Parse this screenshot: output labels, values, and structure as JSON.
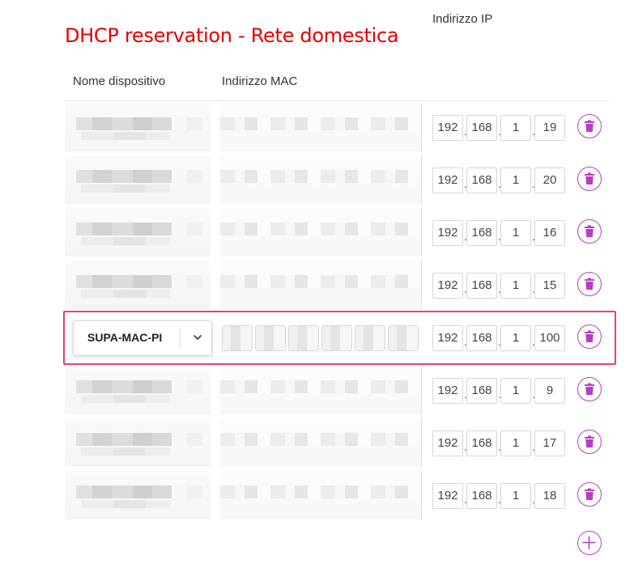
{
  "page": {
    "title": "DHCP reservation - Rete domestica"
  },
  "columns": {
    "name": "Nome dispositivo",
    "mac": "Indirizzo MAC",
    "ip": "Indirizzo IP"
  },
  "rows": [
    {
      "device": "",
      "ip": [
        "192",
        "168",
        "1",
        "19"
      ]
    },
    {
      "device": "",
      "ip": [
        "192",
        "168",
        "1",
        "20"
      ]
    },
    {
      "device": "",
      "ip": [
        "192",
        "168",
        "1",
        "16"
      ]
    },
    {
      "device": "",
      "ip": [
        "192",
        "168",
        "1",
        "15"
      ]
    },
    {
      "device": "SUPA-MAC-PI",
      "ip": [
        "192",
        "168",
        "1",
        "100"
      ],
      "highlighted": true
    },
    {
      "device": "",
      "ip": [
        "192",
        "168",
        "1",
        "9"
      ]
    },
    {
      "device": "",
      "ip": [
        "192",
        "168",
        "1",
        "17"
      ]
    },
    {
      "device": "",
      "ip": [
        "192",
        "168",
        "1",
        "18"
      ]
    }
  ],
  "colors": {
    "title": "#e60000",
    "accent": "#b43fbf",
    "highlight": "#e0447a"
  },
  "icons": {
    "delete": "trash-icon",
    "add": "plus-icon",
    "dropdown": "chevron-down-icon"
  }
}
